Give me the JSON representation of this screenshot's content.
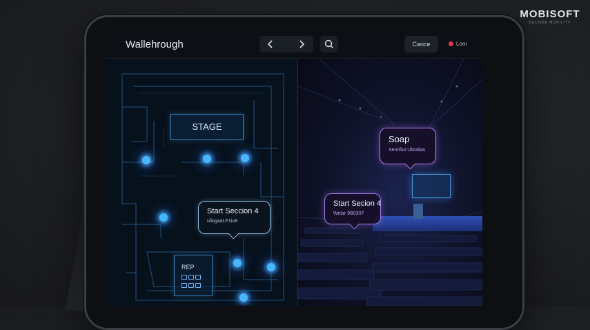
{
  "brand": {
    "name": "MOBISOFT",
    "tagline": "DECODE MOBILITY"
  },
  "header": {
    "title": "Wallehrough",
    "prev_icon": "chevron-left-icon",
    "next_icon": "chevron-right-icon",
    "search_icon": "search-icon",
    "cancel_label": "Cance",
    "status_label": "Loor",
    "status_color": "#e2344f"
  },
  "map": {
    "stage_label": "STAGE",
    "callout": {
      "title": "Start Seccion 4",
      "subtitle": "uliogaaLF1iu8"
    },
    "box_label": "REP",
    "accent_color": "#48b6ff"
  },
  "venue": {
    "callout_top": {
      "title": "Soap",
      "subtitle": "Semifiut Ubraltas"
    },
    "callout_left": {
      "title": "Start Secion 4",
      "subtitle": "Welar 9B0307"
    },
    "accent_color": "#b27ae8"
  }
}
